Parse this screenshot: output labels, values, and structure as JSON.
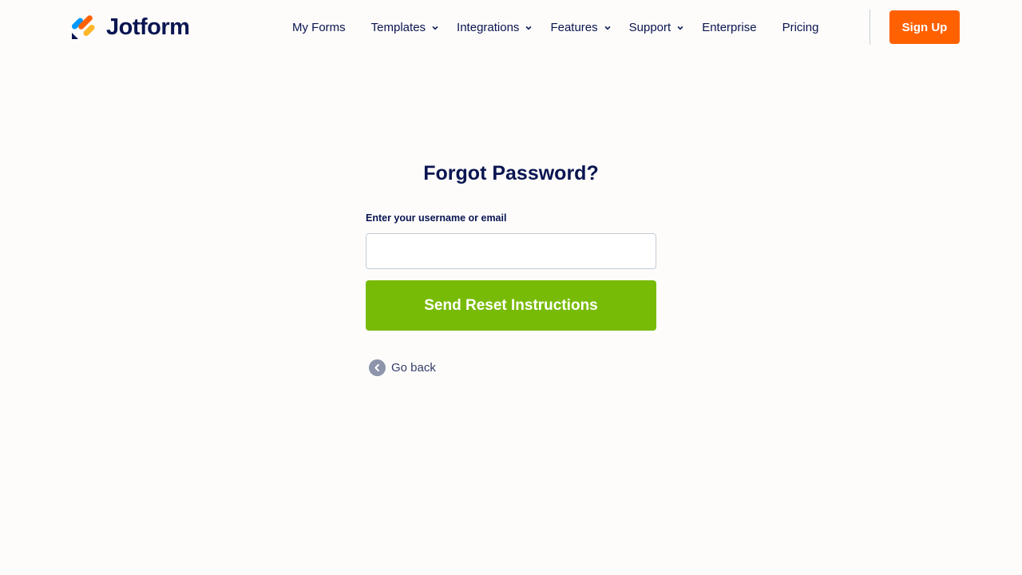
{
  "header": {
    "brand": "Jotform",
    "nav": [
      {
        "label": "My Forms",
        "has_dropdown": false
      },
      {
        "label": "Templates",
        "has_dropdown": true
      },
      {
        "label": "Integrations",
        "has_dropdown": true
      },
      {
        "label": "Features",
        "has_dropdown": true
      },
      {
        "label": "Support",
        "has_dropdown": true
      },
      {
        "label": "Enterprise",
        "has_dropdown": false
      },
      {
        "label": "Pricing",
        "has_dropdown": false
      }
    ],
    "signup_label": "Sign Up"
  },
  "form": {
    "title": "Forgot Password?",
    "field_label": "Enter your username or email",
    "field_value": "",
    "submit_label": "Send Reset Instructions",
    "back_label": "Go back"
  },
  "colors": {
    "brand_navy": "#0a1551",
    "signup_orange": "#ff6100",
    "submit_green": "#78bb07",
    "back_icon_gray": "#8d94ab",
    "background": "#fdfcfa"
  },
  "icons": {
    "logo": "jotform-logo-icon",
    "dropdown": "chevron-down-icon",
    "back": "chevron-left-circle-icon"
  }
}
